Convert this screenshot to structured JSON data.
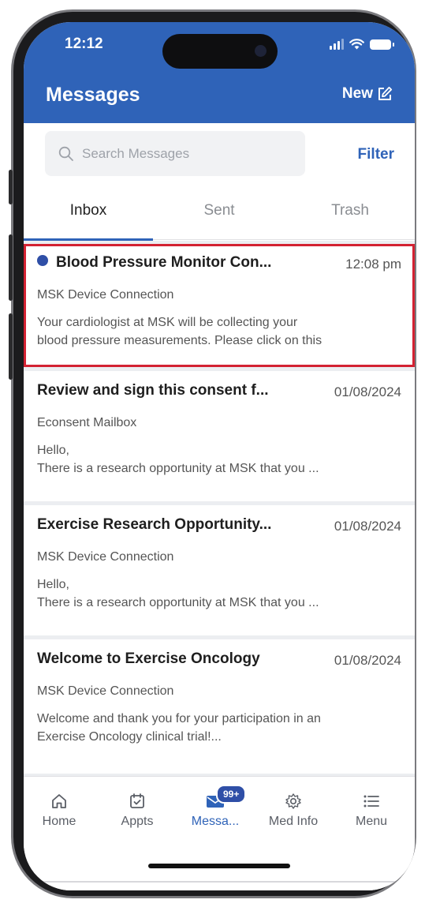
{
  "status": {
    "time": "12:12"
  },
  "header": {
    "title": "Messages",
    "new_label": "New"
  },
  "search": {
    "placeholder": "Search Messages",
    "filter_label": "Filter"
  },
  "tabs": [
    {
      "label": "Inbox",
      "active": true
    },
    {
      "label": "Sent",
      "active": false
    },
    {
      "label": "Trash",
      "active": false
    }
  ],
  "messages": [
    {
      "title": "Blood Pressure Monitor Con...",
      "date": "12:08 pm",
      "from": "MSK Device Connection",
      "preview_line1": "Your cardiologist at MSK will be collecting your",
      "preview_line2": "blood pressure measurements. Please click on this",
      "unread": true,
      "selected": true
    },
    {
      "title": "Review and sign this consent f...",
      "date": "01/08/2024",
      "from": "Econsent Mailbox",
      "preview_line1": "Hello,",
      "preview_line2": "There is a research opportunity at MSK that you ...",
      "unread": false,
      "selected": false
    },
    {
      "title": "Exercise Research Opportunity...",
      "date": "01/08/2024",
      "from": "MSK Device Connection",
      "preview_line1": "Hello,",
      "preview_line2": "There is a research opportunity at MSK that you ...",
      "unread": false,
      "selected": false
    },
    {
      "title": "Welcome to Exercise Oncology",
      "date": "01/08/2024",
      "from": "MSK Device Connection",
      "preview_line1": "Welcome and thank you for your participation in an",
      "preview_line2": "Exercise Oncology clinical trial!...",
      "unread": false,
      "selected": false
    }
  ],
  "tabbar": {
    "items": [
      {
        "label": "Home",
        "icon": "home-icon"
      },
      {
        "label": "Appts",
        "icon": "calendar-icon"
      },
      {
        "label": "Messa...",
        "icon": "mail-icon",
        "badge": "99+",
        "active": true
      },
      {
        "label": "Med Info",
        "icon": "med-info-icon"
      },
      {
        "label": "Menu",
        "icon": "list-menu-icon"
      }
    ]
  },
  "colors": {
    "brand": "#2f63b8",
    "selection": "#d32232",
    "unread_dot": "#2f4fa7"
  }
}
